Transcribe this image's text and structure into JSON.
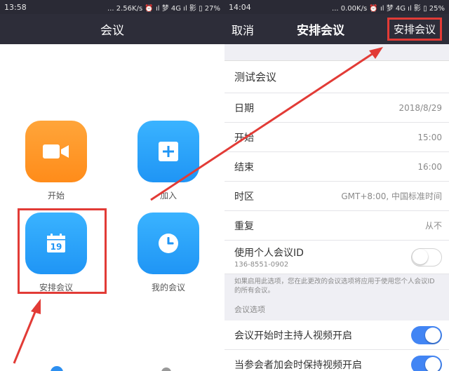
{
  "left_screen": {
    "status": {
      "time": "13:58",
      "right": "... 2.56K/s ⏰ ıl 梦 4G ıl 影 ▯ 27%"
    },
    "header": {
      "title": "会议"
    },
    "tiles": [
      {
        "label": "开始",
        "icon": "video-camera-icon"
      },
      {
        "label": "加入",
        "icon": "plus-icon"
      },
      {
        "label": "安排会议",
        "icon": "calendar-icon",
        "calendar_day": "19"
      },
      {
        "label": "我的会议",
        "icon": "clock-icon"
      }
    ]
  },
  "right_screen": {
    "status": {
      "time": "14:04",
      "right": "... 0.00K/s ⏰ ıl 梦 4G ıl 影 ▯ 25%"
    },
    "header": {
      "cancel": "取消",
      "title": "安排会议",
      "schedule": "安排会议"
    },
    "topic": "测试会议",
    "rows": [
      {
        "label": "日期",
        "value": "2018/8/29"
      },
      {
        "label": "开始",
        "value": "15:00"
      },
      {
        "label": "结束",
        "value": "16:00"
      },
      {
        "label": "时区",
        "value": "GMT+8:00, 中国标准时间"
      },
      {
        "label": "重复",
        "value": "从不"
      }
    ],
    "pmi": {
      "label": "使用个人会议ID",
      "id": "136-8551-0902",
      "enabled": false
    },
    "pmi_note": "如果启用此选项，您在此更改的会议选项将应用于使用您个人会议ID的所有会议。",
    "options_header": "会议选项",
    "options": [
      {
        "label": "会议开始时主持人视频开启",
        "enabled": true
      },
      {
        "label": "当参会者加会时保持视频开启",
        "enabled": true
      }
    ]
  },
  "colors": {
    "header": "#2d2d39",
    "orange": "#ff8c1a",
    "blue": "#1f95f5",
    "highlight": "#e23b36",
    "toggle_on": "#4285f4"
  }
}
